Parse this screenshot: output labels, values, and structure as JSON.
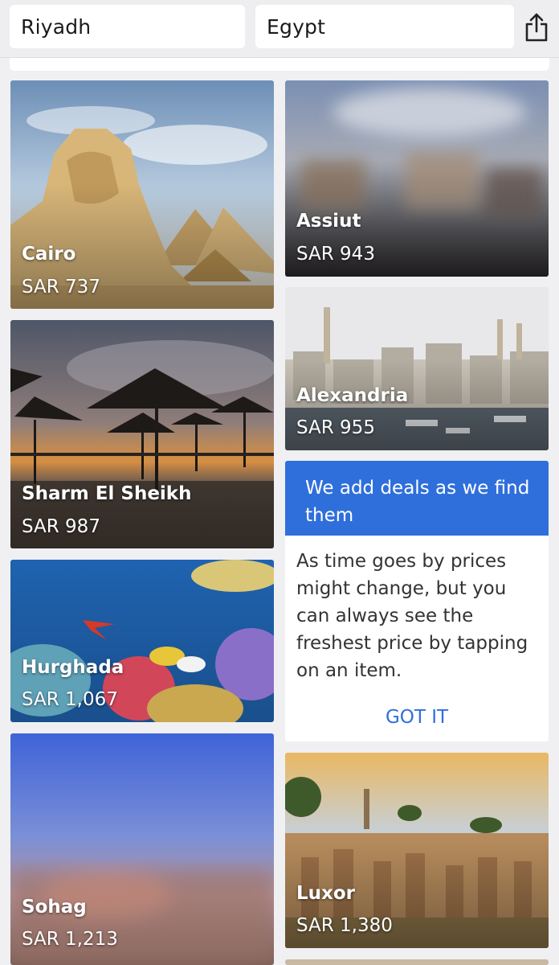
{
  "search": {
    "origin": "Riyadh",
    "destination": "Egypt"
  },
  "cards": [
    {
      "city": "Cairo",
      "price": "SAR 737"
    },
    {
      "city": "Assiut",
      "price": "SAR 943"
    },
    {
      "city": "Alexandria",
      "price": "SAR 955"
    },
    {
      "city": "Sharm El Sheikh",
      "price": "SAR 987"
    },
    {
      "city": "Hurghada",
      "price": "SAR 1,067"
    },
    {
      "city": "Sohag",
      "price": "SAR 1,213"
    },
    {
      "city": "Luxor",
      "price": "SAR 1,380"
    }
  ],
  "tip": {
    "title": "We add deals as we find them",
    "body": "As time goes by prices might change, but you can always see the freshest price by tapping on an item.",
    "button": "GOT IT"
  },
  "icons": {
    "share": "share-icon"
  },
  "colors": {
    "accent": "#2f6fdb"
  }
}
